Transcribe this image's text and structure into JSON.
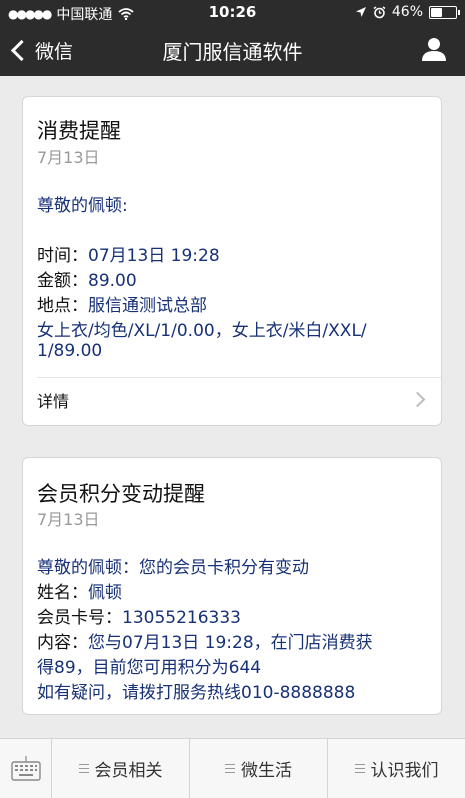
{
  "status_bar": {
    "carrier": "中国联通",
    "time": "10:26",
    "battery": "46%",
    "battery_level": 0.46
  },
  "nav": {
    "back_label": "微信",
    "title": "厦门服信通软件"
  },
  "card1": {
    "title": "消费提醒",
    "date": "7月13日",
    "greeting": "尊敬的佩顿:",
    "time_label": "时间：",
    "time_value": "07月13日 19:28",
    "amount_label": "金额：",
    "amount_value": "89.00",
    "location_label": "地点：",
    "location_value": "服信通测试总部",
    "items_line1": "女上衣/均色/XL/1/0.00，女上衣/米白/XXL/",
    "items_line2": "1/89.00",
    "detail_label": "详情"
  },
  "card2": {
    "title": "会员积分变动提醒",
    "date": "7月13日",
    "line1": "尊敬的佩顿：您的会员卡积分有变动",
    "name_label": "姓名：",
    "name_value": "佩顿",
    "card_label": "会员卡号：",
    "card_value": "13055216333",
    "content_label": "内容：",
    "content_value1": "您与07月13日 19:28，在门店消费获",
    "content_value2": "得89，目前您可用积分为644",
    "footer_line": "如有疑问，请拨打服务热线010-8888888"
  },
  "bottom_menu": [
    {
      "label": "会员相关"
    },
    {
      "label": "微生活"
    },
    {
      "label": "认识我们"
    }
  ]
}
